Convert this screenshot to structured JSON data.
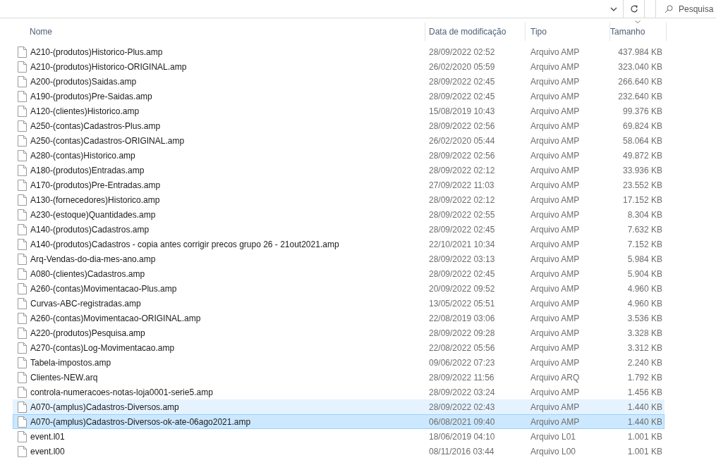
{
  "search": {
    "placeholder": "Pesquisa"
  },
  "columns": [
    {
      "label": "Nome",
      "sorted": false
    },
    {
      "label": "Data de modificação",
      "sorted": false
    },
    {
      "label": "Tipo",
      "sorted": false
    },
    {
      "label": "Tamanho",
      "sorted": true
    }
  ],
  "rows": [
    {
      "name": "A210-(produtos)Historico-Plus.amp",
      "modified": "28/09/2022 02:52",
      "type": "Arquivo AMP",
      "size": "437.984 KB",
      "selected": false,
      "hovered": false
    },
    {
      "name": "A210-(produtos)Historico-ORIGINAL.amp",
      "modified": "26/02/2020 05:59",
      "type": "Arquivo AMP",
      "size": "323.040 KB",
      "selected": false,
      "hovered": false
    },
    {
      "name": "A200-(produtos)Saidas.amp",
      "modified": "28/09/2022 02:45",
      "type": "Arquivo AMP",
      "size": "266.640 KB",
      "selected": false,
      "hovered": false
    },
    {
      "name": "A190-(produtos)Pre-Saidas.amp",
      "modified": "28/09/2022 02:45",
      "type": "Arquivo AMP",
      "size": "232.640 KB",
      "selected": false,
      "hovered": false
    },
    {
      "name": "A120-(clientes)Historico.amp",
      "modified": "15/08/2019 10:43",
      "type": "Arquivo AMP",
      "size": "99.376 KB",
      "selected": false,
      "hovered": false
    },
    {
      "name": "A250-(contas)Cadastros-Plus.amp",
      "modified": "28/09/2022 02:56",
      "type": "Arquivo AMP",
      "size": "69.824 KB",
      "selected": false,
      "hovered": false
    },
    {
      "name": "A250-(contas)Cadastros-ORIGINAL.amp",
      "modified": "26/02/2020 05:44",
      "type": "Arquivo AMP",
      "size": "58.064 KB",
      "selected": false,
      "hovered": false
    },
    {
      "name": "A280-(contas)Historico.amp",
      "modified": "28/09/2022 02:56",
      "type": "Arquivo AMP",
      "size": "49.872 KB",
      "selected": false,
      "hovered": false
    },
    {
      "name": "A180-(produtos)Entradas.amp",
      "modified": "28/09/2022 02:12",
      "type": "Arquivo AMP",
      "size": "33.936 KB",
      "selected": false,
      "hovered": false
    },
    {
      "name": "A170-(produtos)Pre-Entradas.amp",
      "modified": "27/09/2022 11:03",
      "type": "Arquivo AMP",
      "size": "23.552 KB",
      "selected": false,
      "hovered": false
    },
    {
      "name": "A130-(fornecedores)Historico.amp",
      "modified": "28/09/2022 02:12",
      "type": "Arquivo AMP",
      "size": "17.152 KB",
      "selected": false,
      "hovered": false
    },
    {
      "name": "A230-(estoque)Quantidades.amp",
      "modified": "28/09/2022 02:55",
      "type": "Arquivo AMP",
      "size": "8.304 KB",
      "selected": false,
      "hovered": false
    },
    {
      "name": "A140-(produtos)Cadastros.amp",
      "modified": "28/09/2022 02:45",
      "type": "Arquivo AMP",
      "size": "7.632 KB",
      "selected": false,
      "hovered": false
    },
    {
      "name": "A140-(produtos)Cadastros - copia antes corrigir precos grupo 26 - 21out2021.amp",
      "modified": "22/10/2021 10:34",
      "type": "Arquivo AMP",
      "size": "7.152 KB",
      "selected": false,
      "hovered": false
    },
    {
      "name": "Arq-Vendas-do-dia-mes-ano.amp",
      "modified": "28/09/2022 03:13",
      "type": "Arquivo AMP",
      "size": "5.984 KB",
      "selected": false,
      "hovered": false
    },
    {
      "name": "A080-(clientes)Cadastros.amp",
      "modified": "28/09/2022 02:45",
      "type": "Arquivo AMP",
      "size": "5.904 KB",
      "selected": false,
      "hovered": false
    },
    {
      "name": "A260-(contas)Movimentacao-Plus.amp",
      "modified": "20/09/2022 09:52",
      "type": "Arquivo AMP",
      "size": "4.960 KB",
      "selected": false,
      "hovered": false
    },
    {
      "name": "Curvas-ABC-registradas.amp",
      "modified": "13/05/2022 05:51",
      "type": "Arquivo AMP",
      "size": "4.960 KB",
      "selected": false,
      "hovered": false
    },
    {
      "name": "A260-(contas)Movimentacao-ORIGINAL.amp",
      "modified": "22/08/2019 03:06",
      "type": "Arquivo AMP",
      "size": "3.536 KB",
      "selected": false,
      "hovered": false
    },
    {
      "name": "A220-(produtos)Pesquisa.amp",
      "modified": "28/09/2022 09:28",
      "type": "Arquivo AMP",
      "size": "3.328 KB",
      "selected": false,
      "hovered": false
    },
    {
      "name": "A270-(contas)Log-Movimentacao.amp",
      "modified": "22/08/2022 05:56",
      "type": "Arquivo AMP",
      "size": "3.312 KB",
      "selected": false,
      "hovered": false
    },
    {
      "name": "Tabela-impostos.amp",
      "modified": "09/06/2022 07:23",
      "type": "Arquivo AMP",
      "size": "2.240 KB",
      "selected": false,
      "hovered": false
    },
    {
      "name": "Clientes-NEW.arq",
      "modified": "28/09/2022 11:56",
      "type": "Arquivo ARQ",
      "size": "1.792 KB",
      "selected": false,
      "hovered": false
    },
    {
      "name": "controla-numeracoes-notas-loja0001-serie5.amp",
      "modified": "28/09/2022 03:24",
      "type": "Arquivo AMP",
      "size": "1.456 KB",
      "selected": false,
      "hovered": false
    },
    {
      "name": "A070-(amplus)Cadastros-Diversos.amp",
      "modified": "28/09/2022 02:43",
      "type": "Arquivo AMP",
      "size": "1.440 KB",
      "selected": false,
      "hovered": true
    },
    {
      "name": "A070-(amplus)Cadastros-Diversos-ok-ate-06ago2021.amp",
      "modified": "06/08/2021 09:40",
      "type": "Arquivo AMP",
      "size": "1.440 KB",
      "selected": true,
      "hovered": false
    },
    {
      "name": "event.l01",
      "modified": "18/06/2019 04:10",
      "type": "Arquivo L01",
      "size": "1.001 KB",
      "selected": false,
      "hovered": false
    },
    {
      "name": "event.l00",
      "modified": "08/11/2016 03:44",
      "type": "Arquivo L00",
      "size": "1.001 KB",
      "selected": false,
      "hovered": false
    }
  ]
}
